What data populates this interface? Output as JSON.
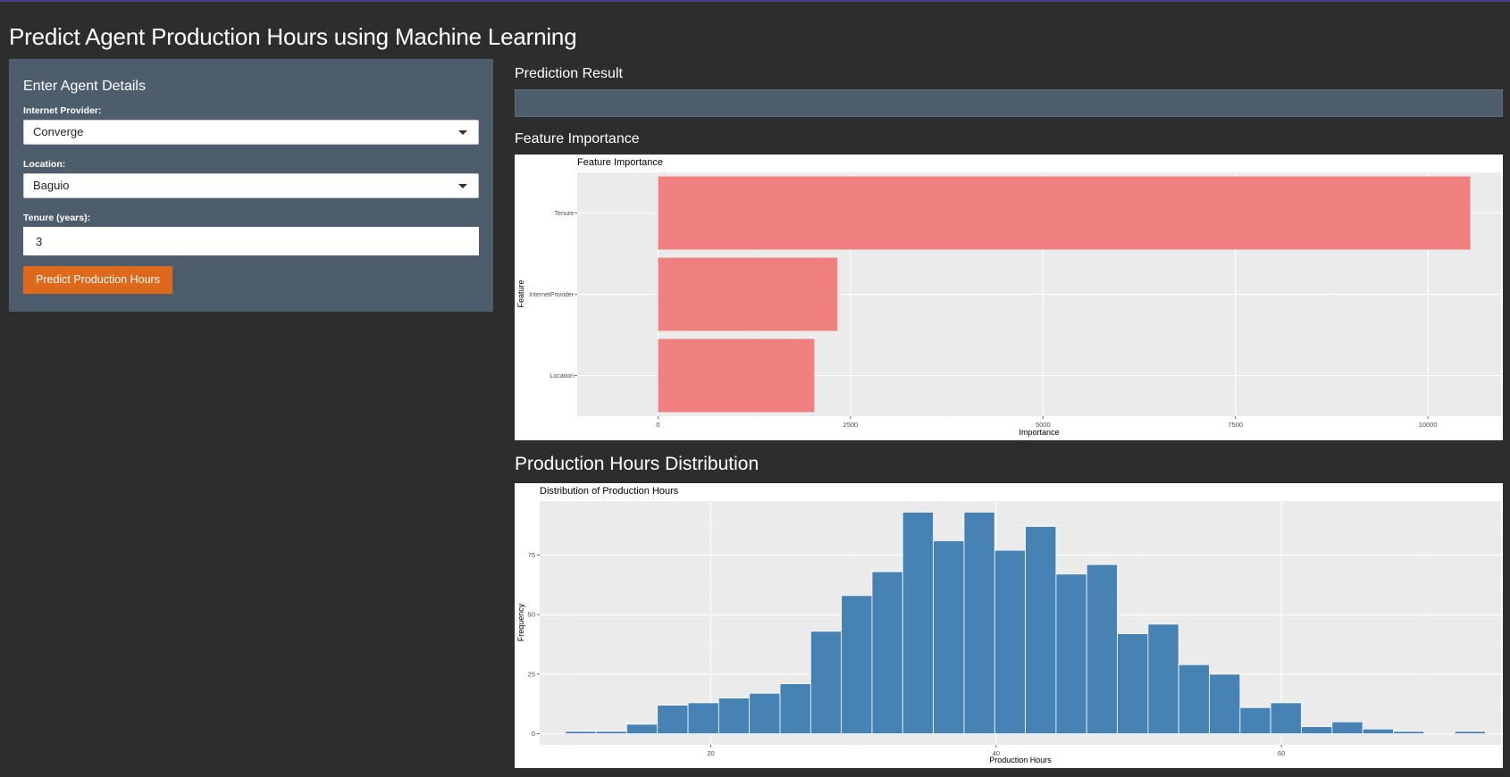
{
  "app": {
    "title": "Predict Agent Production Hours using Machine Learning"
  },
  "sidebar": {
    "title": "Enter Agent Details",
    "internet_provider": {
      "label": "Internet Provider:",
      "value": "Converge"
    },
    "location": {
      "label": "Location:",
      "value": "Baguio"
    },
    "tenure": {
      "label": "Tenure (years):",
      "value": "3"
    },
    "predict_button": "Predict Production Hours"
  },
  "main": {
    "prediction_heading": "Prediction Result",
    "prediction_value": "",
    "feature_heading": "Feature Importance",
    "distribution_heading": "Production Hours Distribution"
  },
  "colors": {
    "bar_importance": "#f08080",
    "bar_hist": "#4682b4",
    "panel": "#4e5d6c",
    "accent": "#df691a"
  },
  "chart_data": [
    {
      "type": "bar",
      "orientation": "horizontal",
      "title": "Feature Importance",
      "xlabel": "Importance",
      "ylabel": "Feature",
      "categories": [
        "Tenure",
        "InternetProvider",
        "Location"
      ],
      "values": [
        10550,
        2330,
        2030
      ],
      "xlim": [
        -1050,
        10950
      ],
      "xticks": [
        0,
        2500,
        5000,
        7500,
        10000
      ],
      "grid": true
    },
    {
      "type": "bar",
      "subtype": "histogram",
      "title": "Distribution of Production Hours",
      "xlabel": "Production Hours",
      "ylabel": "Frequency",
      "bin_width": 2.15,
      "bin_starts": [
        9.8,
        11.95,
        14.1,
        16.25,
        18.4,
        20.55,
        22.7,
        24.85,
        27.0,
        29.15,
        31.3,
        33.45,
        35.6,
        37.75,
        39.9,
        42.05,
        44.2,
        46.35,
        48.5,
        50.65,
        52.8,
        54.95,
        57.1,
        59.25,
        61.4,
        63.55,
        65.7,
        67.85,
        70.0,
        72.15
      ],
      "values": [
        1,
        1,
        4,
        12,
        13,
        15,
        17,
        21,
        43,
        58,
        68,
        93,
        81,
        93,
        77,
        87,
        67,
        71,
        42,
        46,
        29,
        25,
        11,
        13,
        3,
        5,
        2,
        1,
        0,
        1
      ],
      "xlim": [
        8,
        75.4
      ],
      "ylim": [
        -4.65,
        97.65
      ],
      "xticks": [
        20,
        40,
        60
      ],
      "yticks": [
        0,
        25,
        50,
        75
      ],
      "grid": true
    }
  ]
}
